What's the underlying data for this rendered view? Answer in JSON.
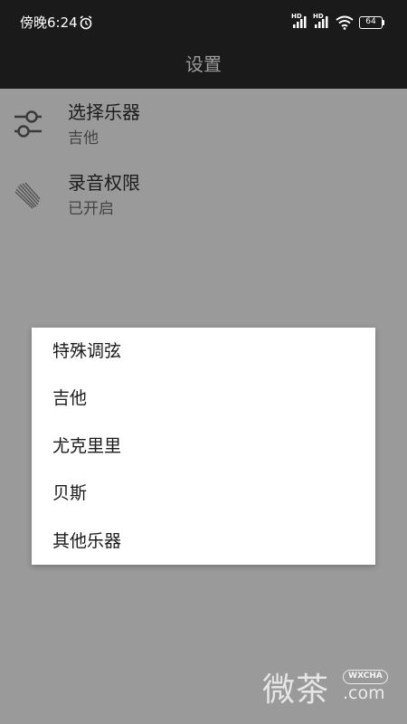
{
  "status_bar": {
    "time": "傍晚6:24",
    "hd_1": "HD",
    "hd_2": "HD",
    "battery": "64"
  },
  "toolbar": {
    "title": "设置"
  },
  "settings": [
    {
      "title": "选择乐器",
      "subtitle": "吉他",
      "icon": "sliders-icon"
    },
    {
      "title": "录音权限",
      "subtitle": "已开启",
      "icon": "meteor-icon"
    }
  ],
  "dialog": {
    "options": [
      "特殊调弦",
      "吉他",
      "尤克里里",
      "贝斯",
      "其他乐器"
    ]
  },
  "watermark": {
    "text": "微茶",
    "badge": "WXCHA",
    "domain": ".com"
  }
}
